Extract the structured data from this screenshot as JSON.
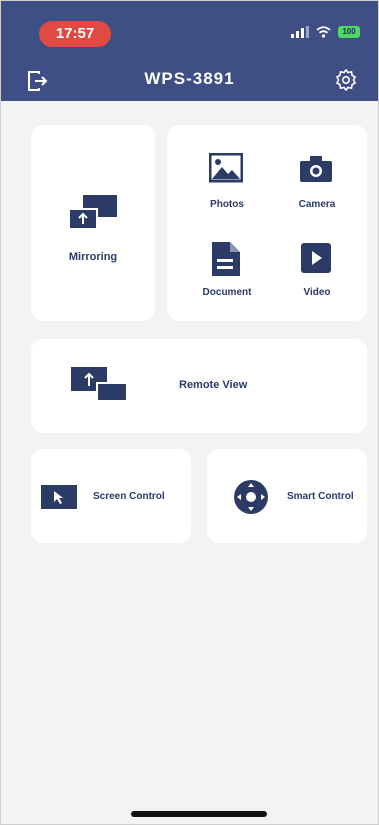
{
  "status_bar": {
    "time": "17:57",
    "battery": "100"
  },
  "header": {
    "title": "WPS-3891",
    "exit_icon": "exit-icon",
    "settings_icon": "settings-icon"
  },
  "tiles": {
    "mirroring": "Mirroring",
    "photos": "Photos",
    "camera": "Camera",
    "document": "Document",
    "video": "Video",
    "remote_view": "Remote View",
    "screen_control": "Screen Control",
    "smart_control": "Smart Control"
  },
  "colors": {
    "header": "#3d4f84",
    "accent": "#2c3a66",
    "time_pill": "#e04a42",
    "background": "#f3f3f3"
  }
}
